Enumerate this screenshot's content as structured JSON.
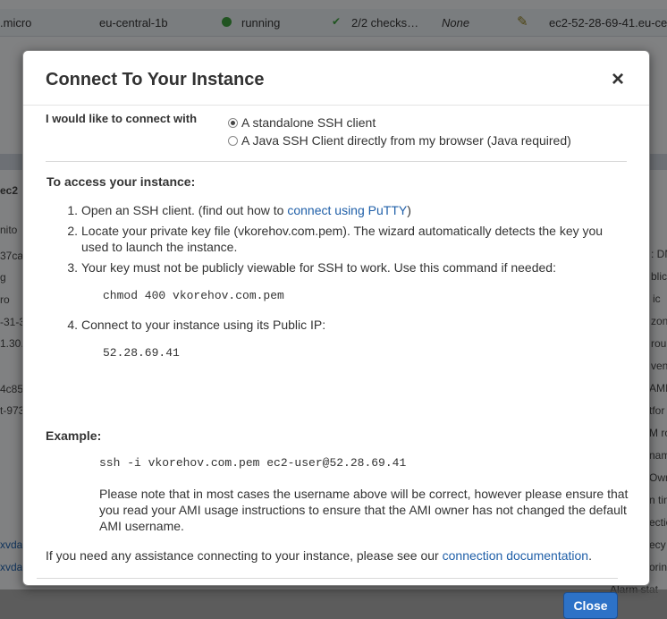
{
  "background": {
    "row": {
      "type": ".micro",
      "zone": "eu-central-1b",
      "state": "running",
      "checks": "2/2 checks…",
      "alarm": "None",
      "dns": "ec2-52-28-69-41.eu-cent"
    },
    "left_fragments": [
      "ec2",
      "nito",
      "37ca",
      "g",
      "ro",
      "-31-3",
      "1.30.",
      "4c85",
      "t-973",
      "xvda",
      "xvda"
    ],
    "right_fragments": [
      ": DN",
      "blic",
      "ic",
      "zon",
      "rou",
      "ven",
      "AMI",
      "tfor",
      "M ro",
      "nam",
      "Own",
      "n tim",
      "ectio",
      "ecy",
      "orin",
      "Alarm stat"
    ]
  },
  "modal": {
    "title": "Connect To Your Instance",
    "close_icon": "×",
    "connect_label": "I would like to connect with",
    "options": [
      {
        "label": "A standalone SSH client",
        "selected": true
      },
      {
        "label": "A Java SSH Client directly from my browser (Java required)",
        "selected": false
      }
    ],
    "access_title": "To access your instance:",
    "steps": [
      {
        "num": "1.",
        "pre": "Open an SSH client. (find out how to ",
        "link": "connect using PuTTY",
        "post": ")"
      },
      {
        "num": "2.",
        "text": "Locate your private key file (vkorehov.com.pem). The wizard automatically detects the key you used to launch the instance."
      },
      {
        "num": "3.",
        "text": "Your key must not be publicly viewable for SSH to work. Use this command if needed:"
      },
      {
        "num": "4.",
        "text": "Connect to your instance using its Public IP:"
      }
    ],
    "chmod_cmd": "chmod 400 vkorehov.com.pem",
    "public_ip": "52.28.69.41",
    "example_title": "Example:",
    "ssh_cmd": "ssh -i vkorehov.com.pem ec2-user@52.28.69.41",
    "note": "Please note that in most cases the username above will be correct, however please ensure that you read your AMI usage instructions to ensure that the AMI owner has not changed the default AMI username.",
    "assist_pre": "If you need any assistance connecting to your instance, please see our ",
    "assist_link": "connection documentation",
    "assist_post": ".",
    "close_button": "Close"
  }
}
